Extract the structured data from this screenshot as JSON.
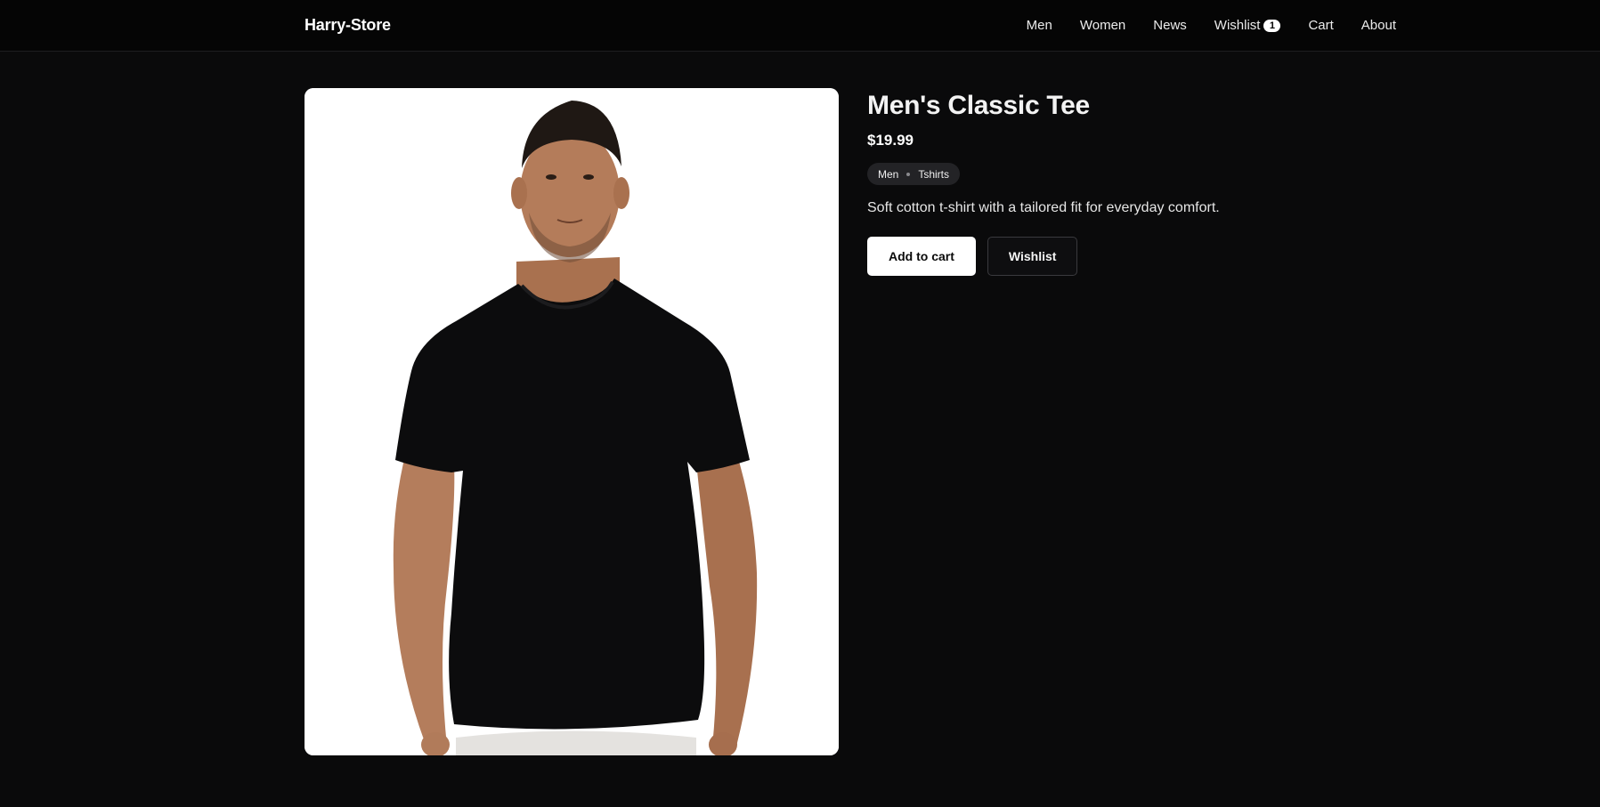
{
  "header": {
    "brand": "Harry-Store",
    "nav": {
      "men": "Men",
      "women": "Women",
      "news": "News",
      "wishlist": "Wishlist",
      "wishlist_count": "1",
      "cart": "Cart",
      "about": "About"
    }
  },
  "product": {
    "image_alt": "Men's Classic Tee",
    "title": "Men's Classic Tee",
    "price": "$19.99",
    "tags": [
      "Men",
      "Tshirts"
    ],
    "description": "Soft cotton t-shirt with a tailored fit for everyday comfort.",
    "add_to_cart_label": "Add to cart",
    "wishlist_label": "Wishlist"
  },
  "colors": {
    "background": "#0a0a0b",
    "header_background": "#050505",
    "primary_button": "#ffffff",
    "tag_background": "#232326"
  },
  "icons": {
    "tag_separator": "dot"
  }
}
